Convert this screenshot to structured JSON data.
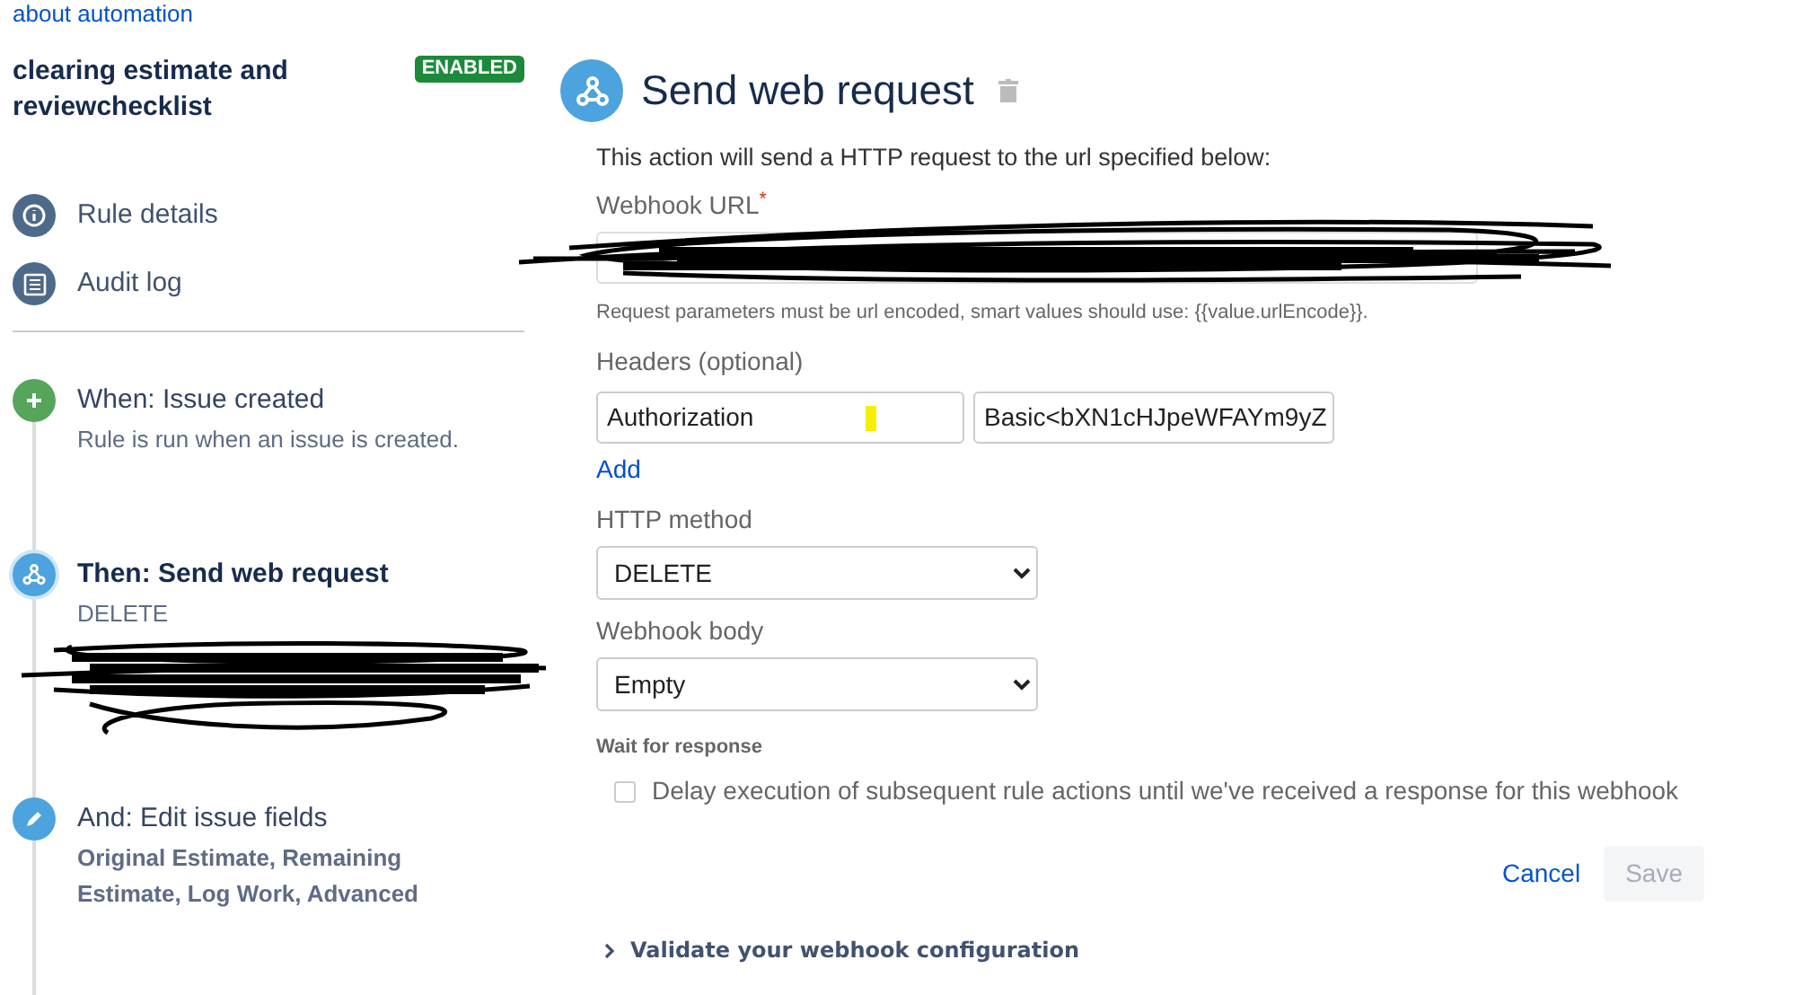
{
  "top_link": "about automation",
  "rule": {
    "name": "clearing estimate and reviewchecklist",
    "status_badge": "ENABLED"
  },
  "nav": [
    {
      "kind": "info",
      "label": "Rule details"
    },
    {
      "kind": "log",
      "label": "Audit log"
    }
  ],
  "steps": [
    {
      "kind": "trigger",
      "title": "When: Issue created",
      "detail": "Rule is run when an issue is created.",
      "detail_bold": false,
      "selected": false
    },
    {
      "kind": "webhook",
      "title": "Then: Send web request",
      "detail": "DELETE",
      "detail_bold": false,
      "selected": true
    },
    {
      "kind": "edit",
      "title": "And: Edit issue fields",
      "detail": "Original Estimate, Remaining Estimate, Log Work, Advanced",
      "detail_bold": true,
      "selected": false
    }
  ],
  "panel": {
    "title": "Send web request",
    "description": "This action will send a HTTP request to the url specified below:",
    "url_label": "Webhook URL",
    "url_required_mark": "*",
    "url_hint": "Request parameters must be url encoded, smart values should use: {{value.urlEncode}}.",
    "headers_label": "Headers (optional)",
    "headers": [
      {
        "name": "Authorization",
        "value": "Basic<bXN1cHJpeWFAYm9yZ"
      }
    ],
    "add_link": "Add",
    "method_label": "HTTP method",
    "method": "DELETE",
    "body_label": "Webhook body",
    "body": "Empty",
    "wait_label": "Wait for response",
    "wait_option": {
      "label": "Delay execution of subsequent rule actions until we've received a response for this webhook",
      "checked": false
    },
    "cancel": "Cancel",
    "save": {
      "label": "Save",
      "disabled": true
    },
    "validate": {
      "label": "Validate your webhook configuration",
      "expanded": false
    }
  }
}
